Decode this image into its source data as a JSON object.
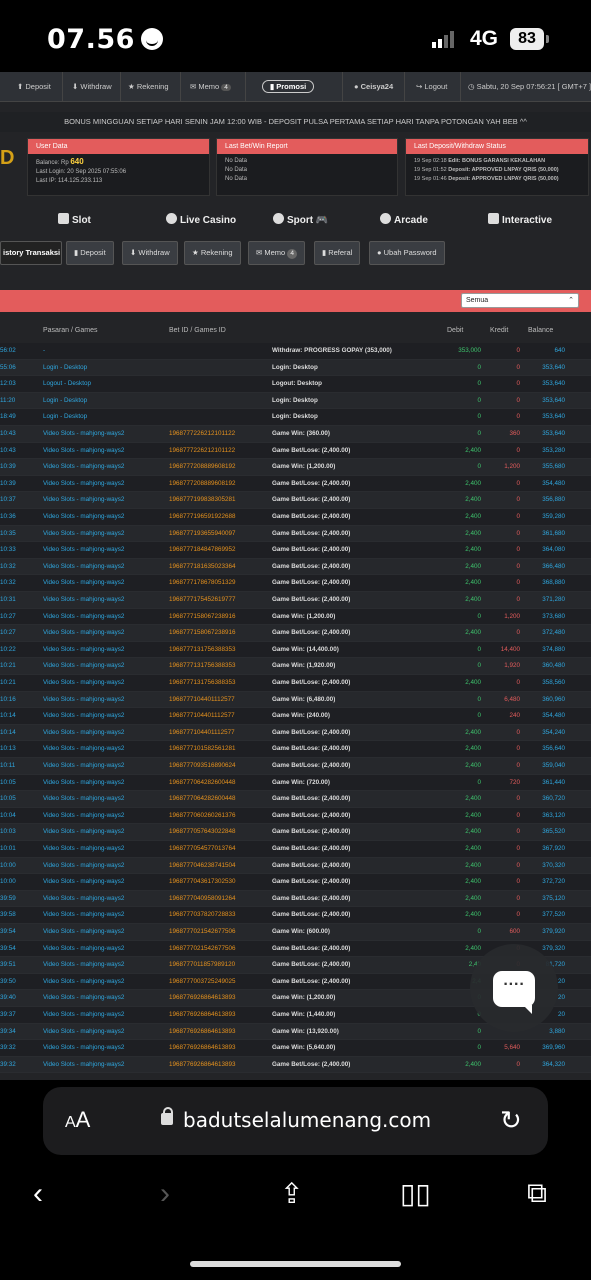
{
  "status_bar": {
    "time": "07.56",
    "network": "4G",
    "battery": "83"
  },
  "top_nav": {
    "deposit": "Deposit",
    "withdraw": "Withdraw",
    "rekening": "Rekening",
    "memo": "Memo",
    "memo_count": "4",
    "promosi": "Promosi",
    "user": "Ceisya24",
    "logout": "Logout",
    "datetime": "Sabtu, 20 Sep 07:56:21 [ GMT+7 ]"
  },
  "marquee": "BONUS MINGGUAN SETIAP HARI SENIN JAM 12:00 WIB - DEPOSIT PULSA PERTAMA SETIAP HARI TANPA POTONGAN YAH BEB ^^",
  "logo_fragment": "D",
  "user_data": {
    "title": "User Data",
    "balance_label": "Balance: Rp",
    "balance": "640",
    "last_login": "Last Login: 20 Sep 2025 07:55:06",
    "last_ip": "Last IP: 114.125.233.113"
  },
  "last_bet": {
    "title": "Last Bet/Win Report",
    "lines": [
      "No Data",
      "No Data",
      "No Data"
    ]
  },
  "last_deposit": {
    "title": "Last Deposit/Withdraw Status",
    "lines": [
      {
        "time": "19 Sep 02:18",
        "text": "Edit: BONUS GARANSI KEKALAHAN"
      },
      {
        "time": "19 Sep 01:52",
        "text": "Deposit: APPROVED LNPAY QRIS (50,000)"
      },
      {
        "time": "19 Sep 01:46",
        "text": "Deposit: APPROVED LNPAY QRIS (50,000)"
      }
    ]
  },
  "categories": [
    "Slot",
    "Live Casino",
    "Sport",
    "Arcade",
    "Interactive"
  ],
  "tabs": {
    "history": "istory Transaksi",
    "deposit": "Deposit",
    "withdraw": "Withdraw",
    "rekening": "Rekening",
    "memo": "Memo",
    "memo_count": "4",
    "referal": "Referal",
    "password": "Ubah Password"
  },
  "filter": {
    "selected": "Semua"
  },
  "table": {
    "headers": {
      "game": "Pasaran / Games",
      "betid": "Bet ID / Games ID",
      "debit": "Debit",
      "kredit": "Kredit",
      "balance": "Balance"
    },
    "rows": [
      [
        "56:02",
        "-",
        "",
        "Withdraw: PROGRESS GOPAY (353,000)",
        "353,000",
        "0",
        "640"
      ],
      [
        "55:06",
        "Login - Desktop",
        "",
        "Login: Desktop",
        "0",
        "0",
        "353,640"
      ],
      [
        "12:03",
        "Logout - Desktop",
        "",
        "Logout: Desktop",
        "0",
        "0",
        "353,640"
      ],
      [
        "11:20",
        "Login - Desktop",
        "",
        "Login: Desktop",
        "0",
        "0",
        "353,640"
      ],
      [
        "18:49",
        "Login - Desktop",
        "",
        "Login: Desktop",
        "0",
        "0",
        "353,640"
      ],
      [
        "10:43",
        "Video Slots - mahjong-ways2",
        "1968777226212101122",
        "Game Win: (360.00)",
        "0",
        "360",
        "353,640"
      ],
      [
        "10:43",
        "Video Slots - mahjong-ways2",
        "1968777226212101122",
        "Game Bet/Lose: (2,400.00)",
        "2,400",
        "0",
        "353,280"
      ],
      [
        "10:39",
        "Video Slots - mahjong-ways2",
        "1968777208889608192",
        "Game Win: (1,200.00)",
        "0",
        "1,200",
        "355,680"
      ],
      [
        "10:39",
        "Video Slots - mahjong-ways2",
        "1968777208889608192",
        "Game Bet/Lose: (2,400.00)",
        "2,400",
        "0",
        "354,480"
      ],
      [
        "10:37",
        "Video Slots - mahjong-ways2",
        "1968777199838305281",
        "Game Bet/Lose: (2,400.00)",
        "2,400",
        "0",
        "356,880"
      ],
      [
        "10:36",
        "Video Slots - mahjong-ways2",
        "1968777196591922688",
        "Game Bet/Lose: (2,400.00)",
        "2,400",
        "0",
        "359,280"
      ],
      [
        "10:35",
        "Video Slots - mahjong-ways2",
        "1968777193655940097",
        "Game Bet/Lose: (2,400.00)",
        "2,400",
        "0",
        "361,680"
      ],
      [
        "10:33",
        "Video Slots - mahjong-ways2",
        "1968777184847869952",
        "Game Bet/Lose: (2,400.00)",
        "2,400",
        "0",
        "364,080"
      ],
      [
        "10:32",
        "Video Slots - mahjong-ways2",
        "1968777181635023364",
        "Game Bet/Lose: (2,400.00)",
        "2,400",
        "0",
        "366,480"
      ],
      [
        "10:32",
        "Video Slots - mahjong-ways2",
        "1968777178678051329",
        "Game Bet/Lose: (2,400.00)",
        "2,400",
        "0",
        "368,880"
      ],
      [
        "10:31",
        "Video Slots - mahjong-ways2",
        "1968777175452619777",
        "Game Bet/Lose: (2,400.00)",
        "2,400",
        "0",
        "371,280"
      ],
      [
        "10:27",
        "Video Slots - mahjong-ways2",
        "1968777158067238916",
        "Game Win: (1,200.00)",
        "0",
        "1,200",
        "373,680"
      ],
      [
        "10:27",
        "Video Slots - mahjong-ways2",
        "1968777158067238916",
        "Game Bet/Lose: (2,400.00)",
        "2,400",
        "0",
        "372,480"
      ],
      [
        "10:22",
        "Video Slots - mahjong-ways2",
        "1968777131756388353",
        "Game Win: (14,400.00)",
        "0",
        "14,400",
        "374,880"
      ],
      [
        "10:21",
        "Video Slots - mahjong-ways2",
        "1968777131756388353",
        "Game Win: (1,920.00)",
        "0",
        "1,920",
        "360,480"
      ],
      [
        "10:21",
        "Video Slots - mahjong-ways2",
        "1968777131756388353",
        "Game Bet/Lose: (2,400.00)",
        "2,400",
        "0",
        "358,560"
      ],
      [
        "10:16",
        "Video Slots - mahjong-ways2",
        "1968777104401112577",
        "Game Win: (6,480.00)",
        "0",
        "6,480",
        "360,960"
      ],
      [
        "10:14",
        "Video Slots - mahjong-ways2",
        "1968777104401112577",
        "Game Win: (240.00)",
        "0",
        "240",
        "354,480"
      ],
      [
        "10:14",
        "Video Slots - mahjong-ways2",
        "1968777104401112577",
        "Game Bet/Lose: (2,400.00)",
        "2,400",
        "0",
        "354,240"
      ],
      [
        "10:13",
        "Video Slots - mahjong-ways2",
        "1968777101582561281",
        "Game Bet/Lose: (2,400.00)",
        "2,400",
        "0",
        "356,640"
      ],
      [
        "10:11",
        "Video Slots - mahjong-ways2",
        "1968777093516890624",
        "Game Bet/Lose: (2,400.00)",
        "2,400",
        "0",
        "359,040"
      ],
      [
        "10:05",
        "Video Slots - mahjong-ways2",
        "1968777064282600448",
        "Game Win: (720.00)",
        "0",
        "720",
        "361,440"
      ],
      [
        "10:05",
        "Video Slots - mahjong-ways2",
        "1968777064282600448",
        "Game Bet/Lose: (2,400.00)",
        "2,400",
        "0",
        "360,720"
      ],
      [
        "10:04",
        "Video Slots - mahjong-ways2",
        "1968777060260261376",
        "Game Bet/Lose: (2,400.00)",
        "2,400",
        "0",
        "363,120"
      ],
      [
        "10:03",
        "Video Slots - mahjong-ways2",
        "1968777057643022848",
        "Game Bet/Lose: (2,400.00)",
        "2,400",
        "0",
        "365,520"
      ],
      [
        "10:01",
        "Video Slots - mahjong-ways2",
        "1968777054577013764",
        "Game Bet/Lose: (2,400.00)",
        "2,400",
        "0",
        "367,920"
      ],
      [
        "10:00",
        "Video Slots - mahjong-ways2",
        "1968777046238741504",
        "Game Bet/Lose: (2,400.00)",
        "2,400",
        "0",
        "370,320"
      ],
      [
        "10:00",
        "Video Slots - mahjong-ways2",
        "1968777043617302530",
        "Game Bet/Lose: (2,400.00)",
        "2,400",
        "0",
        "372,720"
      ],
      [
        "39:59",
        "Video Slots - mahjong-ways2",
        "1968777040958091264",
        "Game Bet/Lose: (2,400.00)",
        "2,400",
        "0",
        "375,120"
      ],
      [
        "39:58",
        "Video Slots - mahjong-ways2",
        "1968777037820728833",
        "Game Bet/Lose: (2,400.00)",
        "2,400",
        "0",
        "377,520"
      ],
      [
        "39:54",
        "Video Slots - mahjong-ways2",
        "1968777021542677506",
        "Game Win: (600.00)",
        "0",
        "600",
        "379,920"
      ],
      [
        "39:54",
        "Video Slots - mahjong-ways2",
        "1968777021542677506",
        "Game Bet/Lose: (2,400.00)",
        "2,400",
        "0",
        "379,320"
      ],
      [
        "39:51",
        "Video Slots - mahjong-ways2",
        "1968777011857989120",
        "Game Bet/Lose: (2,400.00)",
        "2,40",
        "0",
        "81,720"
      ],
      [
        "39:50",
        "Video Slots - mahjong-ways2",
        "1968777003725249025",
        "Game Bet/Lose: (2,400.00)",
        "2,4",
        "",
        "20"
      ],
      [
        "39:40",
        "Video Slots - mahjong-ways2",
        "1968776926864613893",
        "Game Win: (1,200.00)",
        "0",
        "",
        "20"
      ],
      [
        "39:37",
        "Video Slots - mahjong-ways2",
        "1968776926864613893",
        "Game Win: (1,440.00)",
        "0",
        "",
        "20"
      ],
      [
        "39:34",
        "Video Slots - mahjong-ways2",
        "1968776926864613893",
        "Game Win: (13,920.00)",
        "0",
        "",
        "3,880"
      ],
      [
        "39:32",
        "Video Slots - mahjong-ways2",
        "1968776926864613893",
        "Game Win: (5,640.00)",
        "0",
        "5,640",
        "369,960"
      ],
      [
        "39:32",
        "Video Slots - mahjong-ways2",
        "1968776926864613893",
        "Game Bet/Lose: (2,400.00)",
        "2,400",
        "0",
        "364,320"
      ]
    ]
  },
  "browser": {
    "aa_big": "A",
    "aa_small": "A",
    "url": "badutselalumenang.com"
  }
}
